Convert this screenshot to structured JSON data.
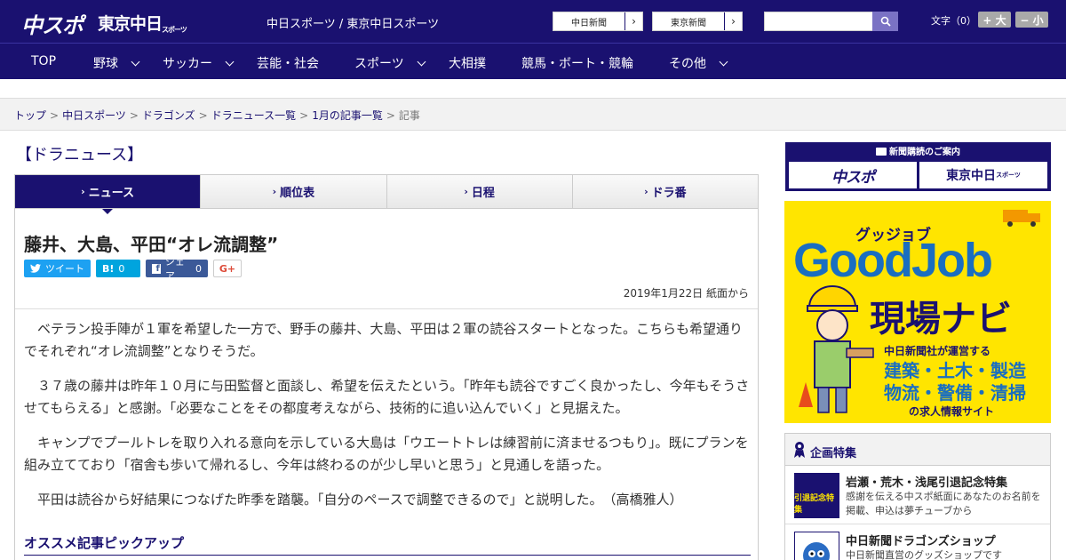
{
  "header": {
    "logo_chunichi_sports": "中スポ",
    "logo_tokyo_chunichi": "東京中日",
    "logo_tokyo_chunichi_small": "スポーツ",
    "tagline": "中日スポーツ / 東京中日スポーツ",
    "link_chunichi": "中日新聞",
    "link_tokyo": "東京新聞",
    "search_placeholder": "",
    "font_size_label": "文字（0）",
    "font_up": "+ 大",
    "font_down": "− 小"
  },
  "nav": {
    "items": [
      {
        "label": "TOP",
        "dropdown": false
      },
      {
        "label": "野球",
        "dropdown": true
      },
      {
        "label": "サッカー",
        "dropdown": true
      },
      {
        "label": "芸能・社会",
        "dropdown": false
      },
      {
        "label": "スポーツ",
        "dropdown": true
      },
      {
        "label": "大相撲",
        "dropdown": false
      },
      {
        "label": "競馬・ボート・競輪",
        "dropdown": false
      },
      {
        "label": "その他",
        "dropdown": true
      }
    ]
  },
  "breadcrumb": {
    "items": [
      "トップ",
      "中日スポーツ",
      "ドラゴンズ",
      "ドラニュース一覧",
      "1月の記事一覧"
    ],
    "current": "記事",
    "separator": ">"
  },
  "section_title": "【ドラニュース】",
  "tabs": [
    "ニュース",
    "順位表",
    "日程",
    "ドラ番"
  ],
  "article": {
    "headline": "藤井、大島、平田“オレ流調整”",
    "share": {
      "tweet": "ツイート",
      "hatena_label": "B!",
      "hatena_count": "0",
      "facebook": "シェア",
      "facebook_count": "0",
      "gplus": "G+"
    },
    "date": "2019年1月22日 紙面から",
    "paragraphs": [
      "ベテラン投手陣が１軍を希望した一方で、野手の藤井、大島、平田は２軍の読谷スタートとなった。こちらも希望通りでそれぞれ“オレ流調整”となりそうだ。",
      "３７歳の藤井は昨年１０月に与田監督と面談し、希望を伝えたという。「昨年も読谷ですごく良かったし、今年もそうさせてもらえる」と感謝。「必要なことをその都度考えながら、技術的に追い込んでいく」と見据えた。",
      "キャンプでプールトレを取り入れる意向を示している大島は「ウエートトレは練習前に済ませるつもり」。既にプランを組み立てており「宿舎も歩いて帰れるし、今年は終わるのが少し早いと思う」と見通しを語った。",
      "平田は読谷から好結果につなげた昨季を踏襲。「自分のペースで調整できるので」と説明した。　（高橋雅人）"
    ],
    "pickup_heading": "オススメ記事ピックアップ"
  },
  "sidebar": {
    "subscribe_heading": "新聞購読のご案内",
    "subscribe_chunichi": "中スポ",
    "subscribe_tokyo": "東京中日",
    "subscribe_tokyo_small": "スポーツ",
    "ad": {
      "kana": "グッジョブ",
      "brand": "GoodJob",
      "title": "現場ナビ",
      "line1": "中日新聞社が運営する",
      "line2": "建築・土木・製造",
      "line3": "物流・警備・清掃",
      "line4": "の求人情報サイト"
    },
    "feature_heading": "企画特集",
    "features": [
      {
        "title": "岩瀬・荒木・浅尾引退記念特集",
        "desc": "感謝を伝える中スポ紙面にあなたのお名前を掲載、申込は夢チューブから",
        "thumb_text": "引退記念特集"
      },
      {
        "title": "中日新聞ドラゴンズショップ",
        "desc": "中日新聞直営のグッズショップです",
        "thumb_text": ""
      }
    ]
  },
  "colors": {
    "brand_navy": "#1a1170",
    "ad_yellow": "#ffe500",
    "ad_blue": "#1a6ec0"
  }
}
